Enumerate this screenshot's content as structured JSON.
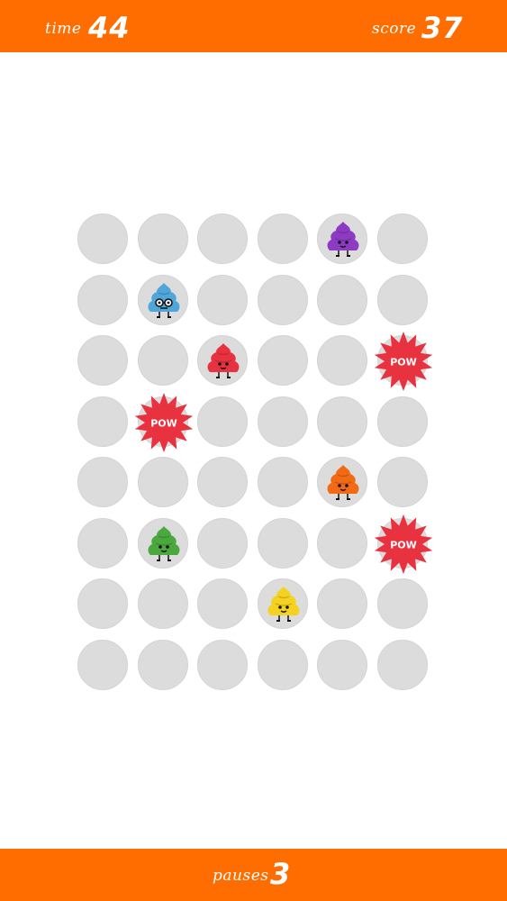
{
  "hud": {
    "time_label": "time",
    "time_value": "44",
    "score_label": "score",
    "score_value": "37",
    "pauses_label": "pauses",
    "pauses_value": "3"
  },
  "colors": {
    "bar": "#ff6d00",
    "hole": "#dcdcdc",
    "pow": "#e8323f",
    "poop_purple": "#8e3bc4",
    "poop_blue": "#4fa6d9",
    "poop_red": "#e8323f",
    "poop_orange": "#f26b14",
    "poop_green": "#4aa83f",
    "poop_yellow": "#f4d21f"
  },
  "board": {
    "rows": 8,
    "cols": 6,
    "occupants": [
      {
        "row": 0,
        "col": 4,
        "type": "poop",
        "color": "purple",
        "icon": "purple-poop-icon"
      },
      {
        "row": 1,
        "col": 1,
        "type": "poop",
        "color": "blue",
        "icon": "blue-poop-glasses-icon"
      },
      {
        "row": 2,
        "col": 2,
        "type": "poop",
        "color": "red",
        "icon": "red-poop-icon"
      },
      {
        "row": 2,
        "col": 5,
        "type": "pow",
        "text": "POW",
        "icon": "pow-burst-icon"
      },
      {
        "row": 3,
        "col": 1,
        "type": "pow",
        "text": "POW",
        "icon": "pow-burst-icon"
      },
      {
        "row": 4,
        "col": 4,
        "type": "poop",
        "color": "orange",
        "icon": "orange-poop-icon"
      },
      {
        "row": 5,
        "col": 1,
        "type": "poop",
        "color": "green",
        "icon": "green-poop-icon"
      },
      {
        "row": 5,
        "col": 5,
        "type": "pow",
        "text": "POW",
        "icon": "pow-burst-icon"
      },
      {
        "row": 6,
        "col": 3,
        "type": "poop",
        "color": "yellow",
        "icon": "yellow-poop-icon"
      }
    ]
  }
}
